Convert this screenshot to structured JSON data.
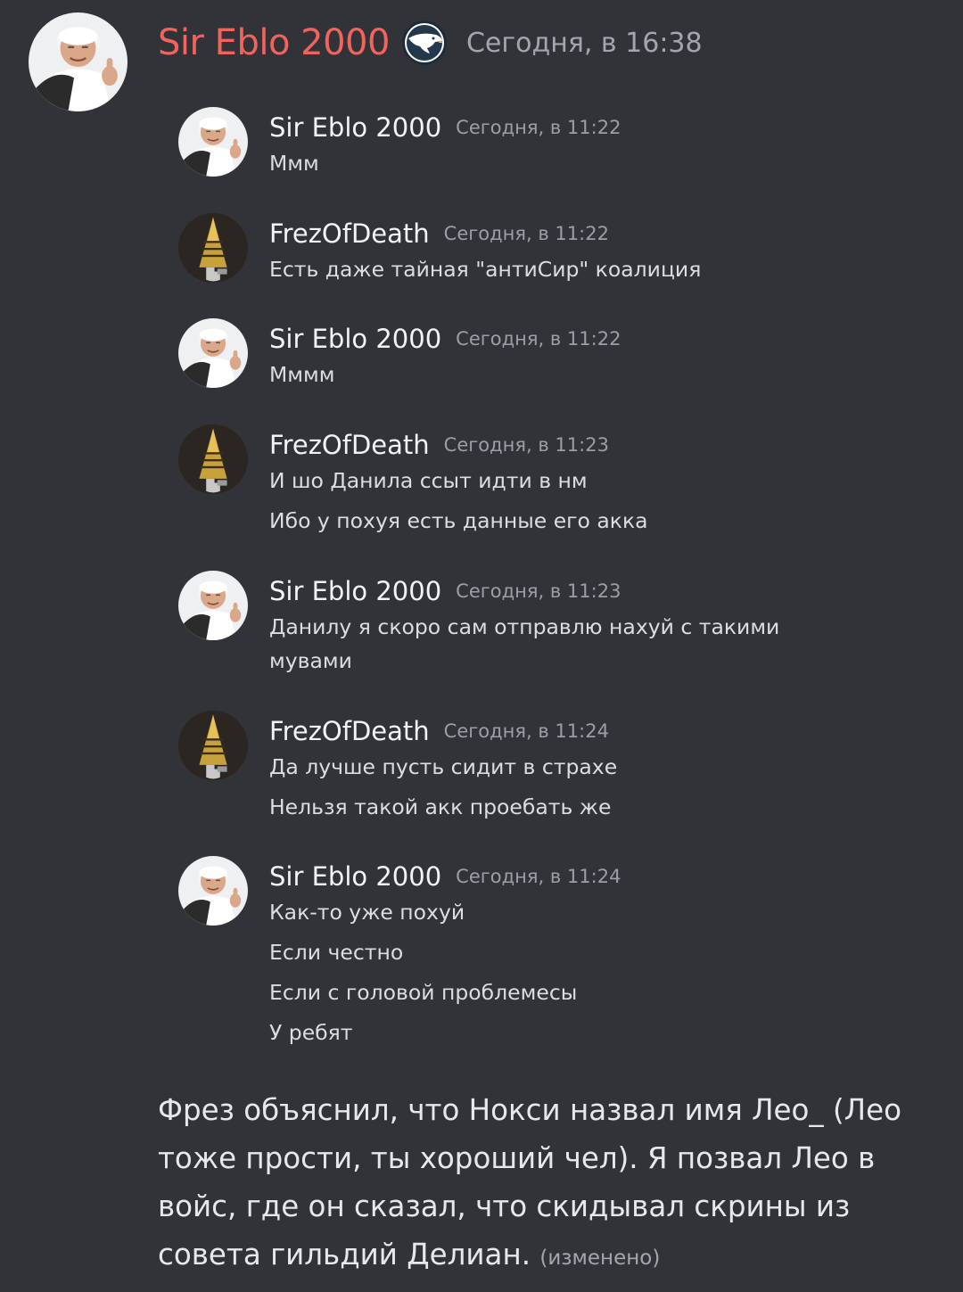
{
  "author": {
    "name": "Sir Eblo 2000",
    "timestamp": "Сегодня, в 16:38",
    "name_color": "#f0645c",
    "avatar_icon": "user-avatar-man-thumbs-up",
    "role_icon": "eagle-emblem-icon"
  },
  "quoted_messages": [
    {
      "author": "Sir Eblo 2000",
      "time": "Сегодня, в 11:22",
      "avatar_icon": "user-avatar-man-thumbs-up",
      "lines": [
        "Ммм"
      ]
    },
    {
      "author": "FrezOfDeath",
      "time": "Сегодня, в 11:22",
      "avatar_icon": "user-avatar-drill-album",
      "lines": [
        "Есть даже тайная \"антиСир\" коалиция"
      ]
    },
    {
      "author": "Sir Eblo 2000",
      "time": "Сегодня, в 11:22",
      "avatar_icon": "user-avatar-man-thumbs-up",
      "lines": [
        "Мммм"
      ]
    },
    {
      "author": "FrezOfDeath",
      "time": "Сегодня, в 11:23",
      "avatar_icon": "user-avatar-drill-album",
      "lines": [
        "И шо Данила ссыт идти в нм",
        "Ибо у похуя есть данные его акка"
      ]
    },
    {
      "author": "Sir Eblo 2000",
      "time": "Сегодня, в 11:23",
      "avatar_icon": "user-avatar-man-thumbs-up",
      "lines": [
        "Данилу я скоро сам отправлю нахуй с такими мувами"
      ]
    },
    {
      "author": "FrezOfDeath",
      "time": "Сегодня, в 11:24",
      "avatar_icon": "user-avatar-drill-album",
      "lines": [
        "Да лучше пусть сидит в страхе",
        "Нельзя такой акк проебать же"
      ]
    },
    {
      "author": "Sir Eblo 2000",
      "time": "Сегодня, в 11:24",
      "avatar_icon": "user-avatar-man-thumbs-up",
      "lines": [
        "Как-то уже похуй",
        "Если честно",
        "Если с головой проблемесы",
        "У ребят"
      ]
    }
  ],
  "body": {
    "text": "Фрез объяснил, что Нокси назвал имя Лео_ (Лео тоже прости, ты хороший чел). Я позвал Лео в войс, где он сказал, что скидывал скрины из совета гильдий Делиан.",
    "edited_label": "(изменено)"
  }
}
